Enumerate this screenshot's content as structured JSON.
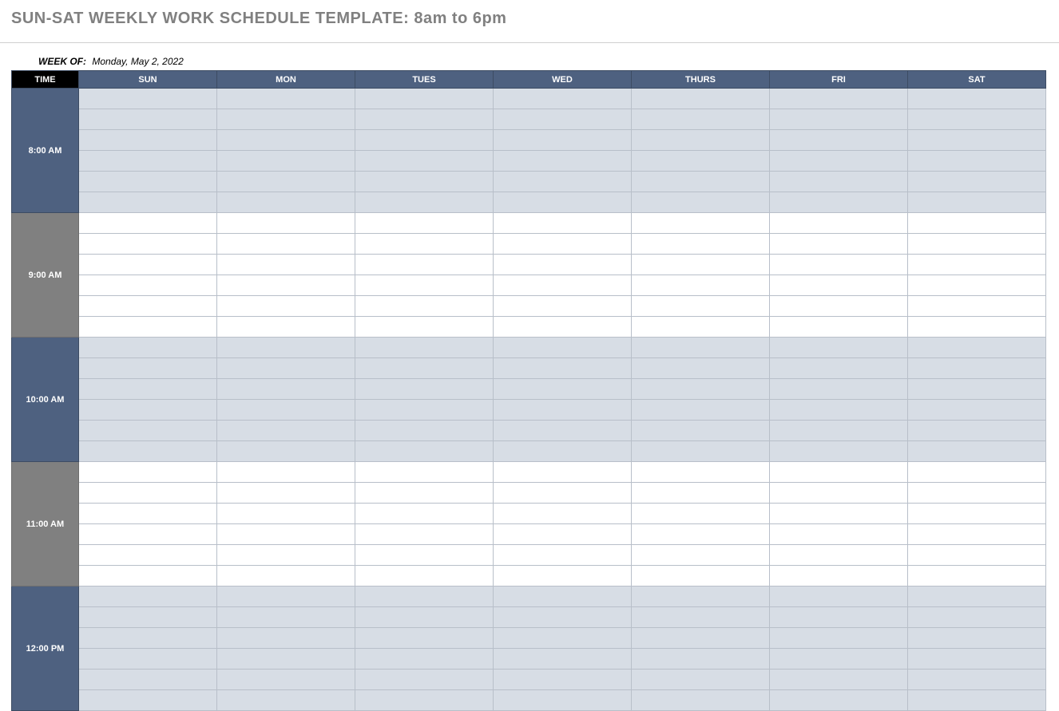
{
  "title": "SUN-SAT WEEKLY WORK SCHEDULE TEMPLATE: 8am to 6pm",
  "week_of_label": "WEEK OF:",
  "week_of_value": "Monday, May 2, 2022",
  "columns": {
    "time": "TIME",
    "days": [
      "SUN",
      "MON",
      "TUES",
      "WED",
      "THURS",
      "FRI",
      "SAT"
    ]
  },
  "hours": [
    {
      "label": "8:00 AM",
      "tone": "blue"
    },
    {
      "label": "9:00 AM",
      "tone": "gray"
    },
    {
      "label": "10:00 AM",
      "tone": "blue"
    },
    {
      "label": "11:00 AM",
      "tone": "gray"
    },
    {
      "label": "12:00 PM",
      "tone": "blue"
    }
  ],
  "subslots_per_hour": 6
}
